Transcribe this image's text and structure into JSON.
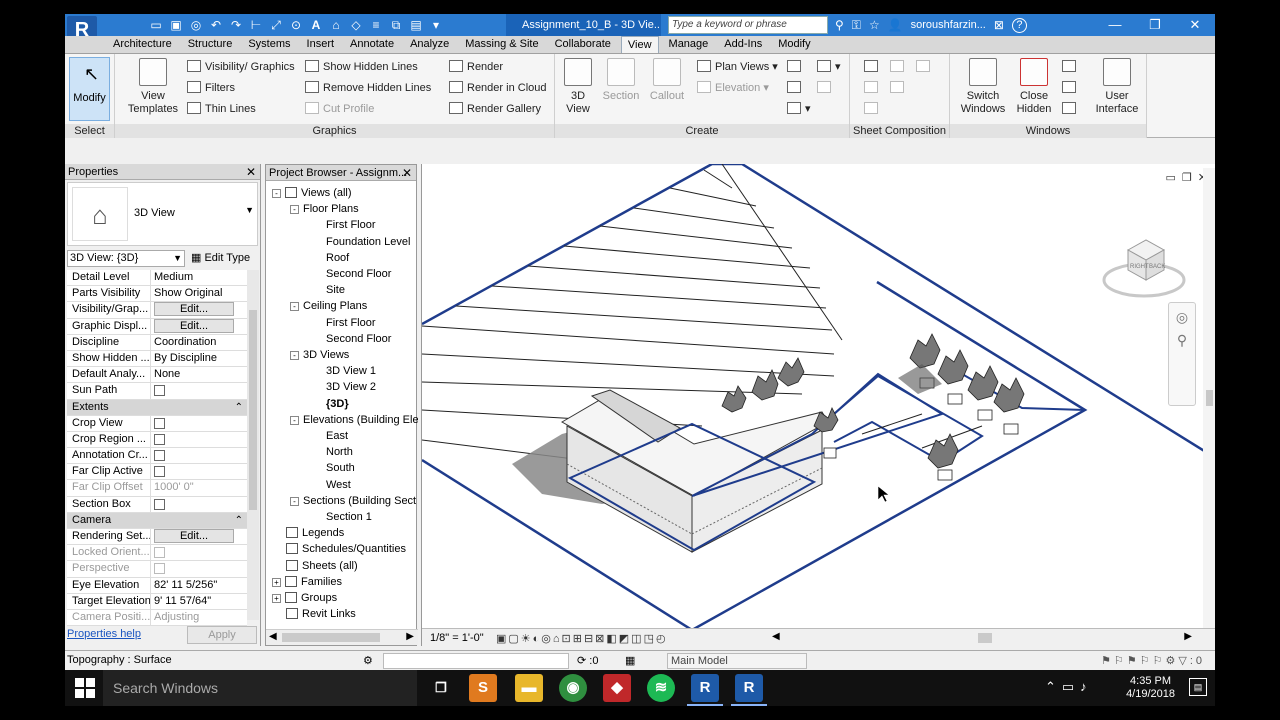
{
  "app": {
    "logo": "R",
    "doc_tab": "Assignment_10_B - 3D Vie...",
    "search_placeholder": "Type a keyword or phrase",
    "user": "soroushfarzin...",
    "help": "?"
  },
  "ribbon_tabs": [
    "Architecture",
    "Structure",
    "Systems",
    "Insert",
    "Annotate",
    "Analyze",
    "Massing & Site",
    "Collaborate",
    "View",
    "Manage",
    "Add-Ins",
    "Modify"
  ],
  "active_tab": "View",
  "ribbon": {
    "select": {
      "modify": "Modify",
      "title": "Select"
    },
    "graphics": {
      "view_templates": "View\nTemplates",
      "visibility": "Visibility/ Graphics",
      "filters": "Filters",
      "thin_lines": "Thin  Lines",
      "show_hidden": "Show  Hidden Lines",
      "remove_hidden": "Remove  Hidden Lines",
      "cut_profile": "Cut  Profile",
      "render": "Render",
      "render_cloud": "Render  in Cloud",
      "render_gallery": "Render  Gallery",
      "title": "Graphics"
    },
    "create": {
      "view3d": "3D\nView",
      "section": "Section",
      "callout": "Callout",
      "plan_views": "Plan  Views",
      "elevation": "Elevation",
      "title": "Create"
    },
    "sheet": {
      "title": "Sheet Composition"
    },
    "windows": {
      "switch": "Switch\nWindows",
      "close_hidden": "Close\nHidden",
      "user_interface": "User\nInterface",
      "title": "Windows"
    }
  },
  "properties": {
    "title": "Properties",
    "type_name": "3D View",
    "selector": "3D View: {3D}",
    "edit_type": "Edit Type",
    "rows": [
      {
        "k": "Detail Level",
        "v": "Medium"
      },
      {
        "k": "Parts Visibility",
        "v": "Show Original"
      },
      {
        "k": "Visibility/Grap...",
        "v": "Edit...",
        "btn": true
      },
      {
        "k": "Graphic Displ...",
        "v": "Edit...",
        "btn": true
      },
      {
        "k": "Discipline",
        "v": "Coordination"
      },
      {
        "k": "Show Hidden ...",
        "v": "By Discipline"
      },
      {
        "k": "Default Analy...",
        "v": "None"
      },
      {
        "k": "Sun Path",
        "cb": true
      },
      {
        "k": "Extents",
        "grp": true
      },
      {
        "k": "Crop View",
        "cb": true
      },
      {
        "k": "Crop Region ...",
        "cb": true
      },
      {
        "k": "Annotation Cr...",
        "cb": true
      },
      {
        "k": "Far Clip Active",
        "cb": true
      },
      {
        "k": "Far Clip Offset",
        "v": "1000'  0\"",
        "dis": true
      },
      {
        "k": "Section Box",
        "cb": true
      },
      {
        "k": "Camera",
        "grp": true
      },
      {
        "k": "Rendering Set...",
        "v": "Edit...",
        "btn": true
      },
      {
        "k": "Locked Orient...",
        "cb": true,
        "dis": true
      },
      {
        "k": "Perspective",
        "cb": true,
        "dis": true
      },
      {
        "k": "Eye Elevation",
        "v": "82'  11 5/256\""
      },
      {
        "k": "Target Elevation",
        "v": "9'  11 57/64\""
      },
      {
        "k": "Camera Positi...",
        "v": "Adjusting",
        "dis": true
      }
    ],
    "help": "Properties help",
    "apply": "Apply"
  },
  "browser": {
    "title": "Project Browser - Assignm...",
    "nodes": [
      {
        "label": "Views (all)",
        "lvl": 0,
        "tg": "-",
        "ic": true
      },
      {
        "label": "Floor Plans",
        "lvl": 1,
        "tg": "-"
      },
      {
        "label": "First Floor",
        "lvl": 2
      },
      {
        "label": "Foundation Level",
        "lvl": 2
      },
      {
        "label": "Roof",
        "lvl": 2
      },
      {
        "label": "Second Floor",
        "lvl": 2
      },
      {
        "label": "Site",
        "lvl": 2
      },
      {
        "label": "Ceiling Plans",
        "lvl": 1,
        "tg": "-"
      },
      {
        "label": "First Floor",
        "lvl": 2
      },
      {
        "label": "Second Floor",
        "lvl": 2
      },
      {
        "label": "3D Views",
        "lvl": 1,
        "tg": "-"
      },
      {
        "label": "3D View 1",
        "lvl": 2
      },
      {
        "label": "3D View 2",
        "lvl": 2
      },
      {
        "label": "{3D}",
        "lvl": 2,
        "bold": true
      },
      {
        "label": "Elevations (Building Ele",
        "lvl": 1,
        "tg": "-"
      },
      {
        "label": "East",
        "lvl": 2
      },
      {
        "label": "North",
        "lvl": 2
      },
      {
        "label": "South",
        "lvl": 2
      },
      {
        "label": "West",
        "lvl": 2
      },
      {
        "label": "Sections (Building Sect",
        "lvl": 1,
        "tg": "-"
      },
      {
        "label": "Section 1",
        "lvl": 2
      },
      {
        "label": "Legends",
        "lvl": 0,
        "ic": true
      },
      {
        "label": "Schedules/Quantities",
        "lvl": 0,
        "ic": true
      },
      {
        "label": "Sheets (all)",
        "lvl": 0,
        "ic": true
      },
      {
        "label": "Families",
        "lvl": 0,
        "tg": "+",
        "ic": true
      },
      {
        "label": "Groups",
        "lvl": 0,
        "tg": "+",
        "ic": true
      },
      {
        "label": "Revit Links",
        "lvl": 0,
        "ic": true
      }
    ]
  },
  "viewport": {
    "scale": "1/8\" = 1'-0\"",
    "viewcube_labels": [
      "RIGHT",
      "BACK"
    ]
  },
  "status": {
    "text": "Topography : Surface",
    "zero": ":0",
    "model": "Main Model",
    "filter_count": ":0"
  },
  "taskbar": {
    "search": "Search Windows",
    "time": "4:35 PM",
    "date": "4/19/2018"
  },
  "colors": {
    "title_blue": "#2b7bd0",
    "doc_tab": "#1a63b8",
    "topo_line": "#1f3c8c"
  }
}
